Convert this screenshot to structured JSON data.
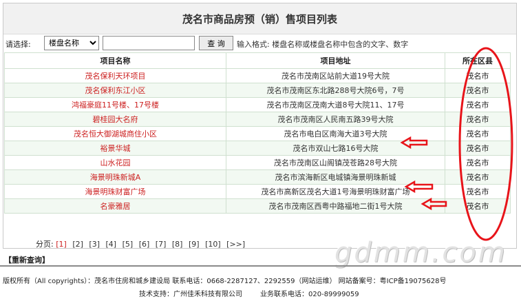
{
  "page": {
    "title": "茂名市商品房预（销）售项目列表"
  },
  "search": {
    "label": "请选择:",
    "field_select": "楼盘名称",
    "input_value": "",
    "button_label": "查 询",
    "hint": "输入格式: 楼盘名称或楼盘名称中包含的文字、数字"
  },
  "table": {
    "headers": [
      "项目名称",
      "项目地址",
      "所在区县"
    ],
    "rows": [
      {
        "name": "茂名保利天环项目",
        "address": "茂名市茂南区站前大道19号大院",
        "district": "茂名市"
      },
      {
        "name": "茂名保利东江小区",
        "address": "茂名市茂南区东北路288号大院6号，7号",
        "district": "茂名市"
      },
      {
        "name": "鸿福豪庭11号楼、17号楼",
        "address": "茂名市茂南区茂南大道8号大院11、17号",
        "district": "茂名市"
      },
      {
        "name": "碧桂园大名府",
        "address": "茂名市茂南区人民南五路39号大院",
        "district": "茂名市"
      },
      {
        "name": "茂名恒大御湖城商住小区",
        "address": "茂名市电白区南海大道3号大院",
        "district": "茂名市"
      },
      {
        "name": "裕景华城",
        "address": "茂名市双山七路16号大院",
        "district": "茂名市"
      },
      {
        "name": "山水花园",
        "address": "茂名市茂南区山阁镇茂苍路28号大院",
        "district": "茂名市"
      },
      {
        "name": "海景明珠新城A",
        "address": "茂名市滨海新区电城镇海景明珠新城",
        "district": "茂名市"
      },
      {
        "name": "海景明珠财富广场",
        "address": "茂名市高新区茂名大道1号海景明珠财富广场",
        "district": "茂名市"
      },
      {
        "name": "名豪雅居",
        "address": "茂名市茂南区西粤中路福地二街1号大院",
        "district": "茂名市"
      }
    ]
  },
  "pager": {
    "label": "分页:",
    "pages": [
      "[1]",
      "[2]",
      "[3]",
      "[4]",
      "[5]",
      "[6]",
      "[7]",
      "[8]",
      "[9]",
      "[10]",
      "[>>]"
    ],
    "current": "[1]"
  },
  "requery_label": "【重新查询】",
  "footer": {
    "line1": "版权所有（All copyrights）：茂名市住房和城乡建设局 联系电话：0668-2287127、2292559（网站运维） 网站备案号：粤ICP备19075628号",
    "support": "技术支持：广州佳禾科技有限公司",
    "phone": "业务联系电话：020-89999059"
  },
  "watermark": "gdmm.com",
  "annotation_color": "#e8141a"
}
